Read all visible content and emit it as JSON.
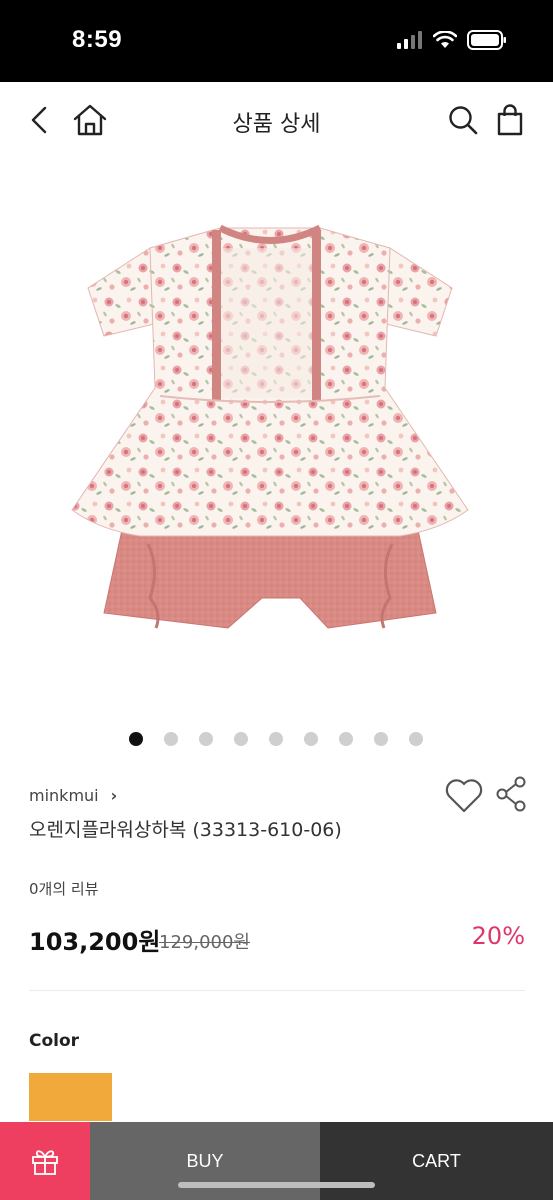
{
  "status_bar": {
    "time": "8:59"
  },
  "header": {
    "title": "상품 상세"
  },
  "carousel": {
    "total": 9,
    "active_index": 0
  },
  "product": {
    "brand": "minkmui",
    "name": "오렌지플라워상하복 (33313-610-06)",
    "review_count": "0개의 리뷰",
    "sale_price": "103,200원",
    "original_price": "129,000원",
    "discount": "20%"
  },
  "options": {
    "color_label": "Color",
    "selected_color": "#f0a93a"
  },
  "bottom_bar": {
    "buy_label": "BUY",
    "cart_label": "CART"
  },
  "colors": {
    "accent": "#e0356b",
    "gift_button": "#ef3f61",
    "buy_button": "#666666",
    "cart_button": "#333333"
  },
  "icons": [
    "back-icon",
    "home-icon",
    "search-icon",
    "bag-icon",
    "heart-icon",
    "share-icon",
    "gift-icon"
  ]
}
